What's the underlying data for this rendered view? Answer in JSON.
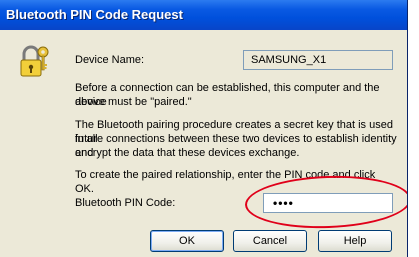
{
  "window": {
    "title": "Bluetooth PIN Code Request"
  },
  "device": {
    "label": "Device Name:",
    "value": "SAMSUNG_X1"
  },
  "text": {
    "para1_line1": "Before a connection can be established, this computer and the device",
    "para1_line2": "above must be \"paired.\"",
    "para2_line1": "The Bluetooth pairing procedure creates a secret key that is used in all",
    "para2_line2": "future connections between these two devices to establish identity and",
    "para2_line3": "encrypt the data that these devices exchange.",
    "para3": "To create the paired relationship, enter the PIN code and click OK."
  },
  "pin": {
    "label": "Bluetooth PIN Code:",
    "value": "••••"
  },
  "buttons": {
    "ok": "OK",
    "cancel": "Cancel",
    "help": "Help"
  },
  "colors": {
    "title_bar": "#0a5ae3",
    "dialog_bg": "#ece9d8",
    "highlight": "#e0001a"
  },
  "icons": {
    "dialog_icon": "key-lock-icon"
  }
}
